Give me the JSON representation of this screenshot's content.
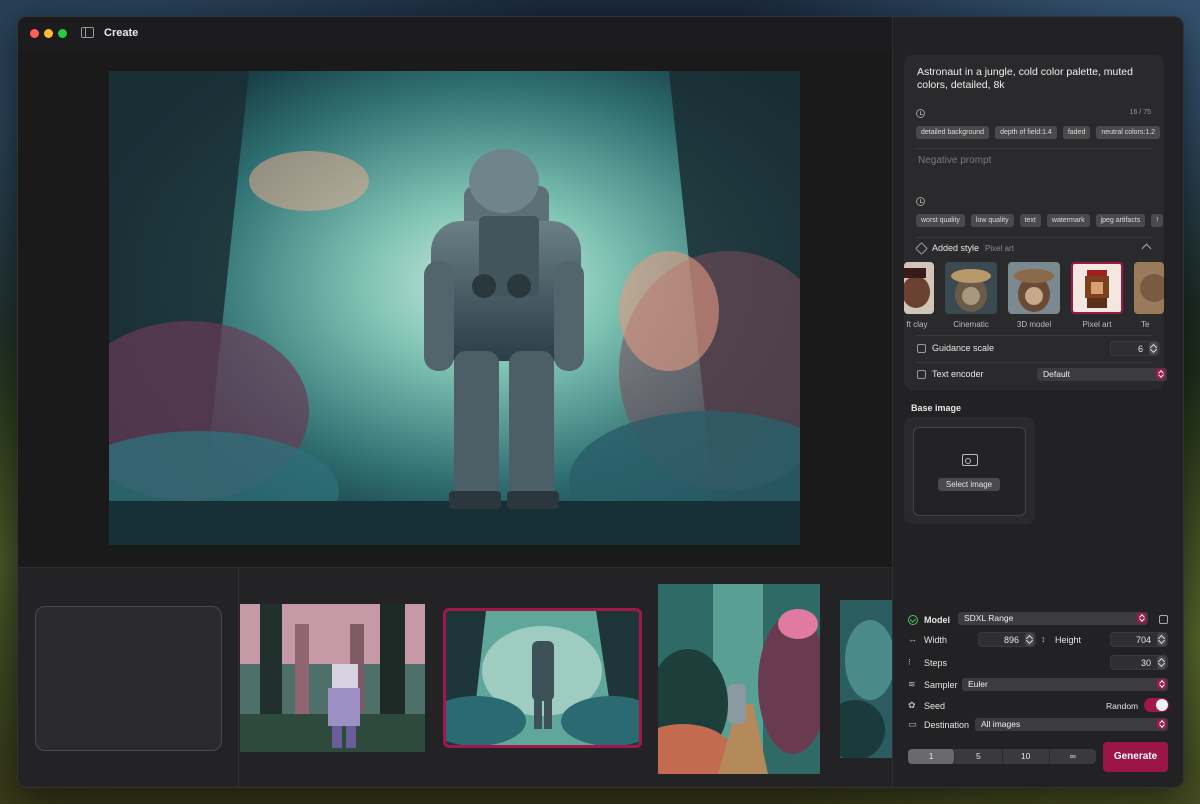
{
  "window": {
    "title": "Create"
  },
  "prompt": {
    "text": "Astronaut in a jungle, cold color palette, muted colors, detailed, 8k",
    "token_count": "16 / 75",
    "tags": [
      "detailed background",
      "depth of field:1.4",
      "faded",
      "neutral colors:1.2"
    ]
  },
  "negative_prompt": {
    "placeholder": "Negative prompt",
    "tags": [
      "worst quality",
      "low quality",
      "text",
      "watermark",
      "jpeg artifacts",
      "!"
    ]
  },
  "style": {
    "label": "Added style",
    "selected": "Pixel art",
    "items": [
      {
        "label": "ft clay"
      },
      {
        "label": "Cinematic"
      },
      {
        "label": "3D model"
      },
      {
        "label": "Pixel art"
      },
      {
        "label": "Te"
      }
    ]
  },
  "guidance": {
    "label": "Guidance scale",
    "value": "6"
  },
  "text_encoder": {
    "label": "Text encoder",
    "value": "Default"
  },
  "base_image": {
    "title": "Base image",
    "button": "Select image"
  },
  "model": {
    "label": "Model",
    "value": "SDXL Range"
  },
  "dimensions": {
    "width_label": "Width",
    "width": "896",
    "height_label": "Height",
    "height": "704"
  },
  "steps": {
    "label": "Steps",
    "value": "30"
  },
  "sampler": {
    "label": "Sampler",
    "value": "Euler"
  },
  "seed": {
    "label": "Seed",
    "random_label": "Random"
  },
  "destination": {
    "label": "Destination",
    "value": "All images"
  },
  "batch": {
    "options": [
      "1",
      "5",
      "10",
      "∞"
    ],
    "selected": "1"
  },
  "generate": {
    "label": "Generate"
  },
  "colors": {
    "accent": "#a0184a",
    "panel": "#222224"
  }
}
